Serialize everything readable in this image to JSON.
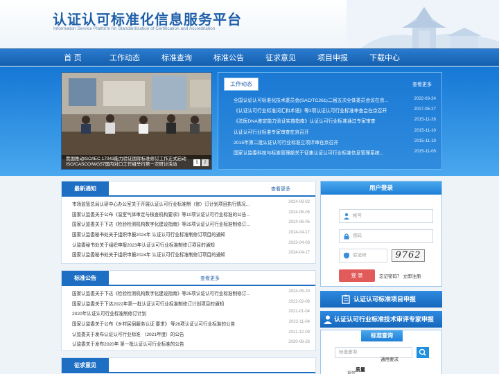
{
  "header": {
    "title": "认证认可标准化信息服务平台",
    "subtitle": "Information Service Platform for Standardization of Certification and Accreditation"
  },
  "nav": [
    "首 页",
    "工作动态",
    "标准查询",
    "标准公告",
    "征求意见",
    "项目申报",
    "下载中心"
  ],
  "slider": {
    "caption": "我国推动ISO/IEC 17043能力验证国际标准修订工作正式启动 ISO/CASCO/WG57国内对口工作组举行第一次研讨活动",
    "pages": [
      "1",
      "2"
    ]
  },
  "work_news": {
    "tab": "工作动态",
    "more": "查看更多",
    "items": [
      {
        "title": "全国认证认可标准化技术委员会(SAC/TC261)二届五次全体委员会议在京...",
        "date": "2022-03-24"
      },
      {
        "title": "《认证认可行业标准词汇和术语》等2项认证认可行业标准审查会在京召开",
        "date": "2017-06-27"
      },
      {
        "title": "《法医DNA鉴定能力验证实施指南》认证认可行业标准通过专家审查",
        "date": "2015-11-26"
      },
      {
        "title": "认证认可行业标准专家审查在京召开",
        "date": "2015-11-10"
      },
      {
        "title": "2015年第二批认证认可行业标准立项评审在京召开",
        "date": "2015-11-10"
      },
      {
        "title": "国家认监委科技与标准管理部关于征集认证认可行业标准信息管理系统...",
        "date": "2015-11-05"
      }
    ]
  },
  "latest_notice": {
    "tab": "最新通知",
    "more": "查看更多",
    "items": [
      {
        "title": "市场监管总局认研中心办公室关于开展认证认可行业标准制（修）订计划项目执行情况...",
        "date": "2024-09-02"
      },
      {
        "title": "国家认监委关于公布《温室气体审定与核查机构要求》等10项认证认可行业标准的公告...",
        "date": "2024-06-05"
      },
      {
        "title": "国家认监委关于下达《检验检测机构数字化建设指南》等25项认证认可行业标准制修订...",
        "date": "2024-06-05"
      },
      {
        "title": "国家认监委秘书处关于组织申报2024年 认证认可行业标准制修订项目的通知",
        "date": "2024-04-17"
      },
      {
        "title": "认监委秘书处关于组织申报2023年认证认可行业标准制修订项目的通知",
        "date": "2023-04-03"
      },
      {
        "title": "国家认监委秘书处关于组织申报2024年 认证认可行业标准制修订项目的通知",
        "date": "2024-04-17"
      }
    ]
  },
  "standard_notice": {
    "tab": "标准公告",
    "more": "查看更多",
    "items": [
      {
        "title": "国家认监委关于下达《检验检测机构数字化建设指南》等25项认证认可行业标准制修订...",
        "date": "2024-05-20"
      },
      {
        "title": "国家认监委关于下达2022年第一批认证认可行业标准制修订计划项目的通知",
        "date": "2022-02-08"
      },
      {
        "title": "2020年认证认可行业标准制修订计划",
        "date": "2021-01-04"
      },
      {
        "title": "国家认监委关于公布《乡村民宿服务认证 要求》 等26项认证认可行业标准的公告",
        "date": "2022-11-04"
      },
      {
        "title": "认监委关于发布认证认可行业标准 （2021年度）的公告",
        "date": "2021-12-09"
      },
      {
        "title": "认监委关于发布2020年 第一批认证认可行业标准的公告",
        "date": "2020-08-26"
      }
    ]
  },
  "consult": {
    "tab": "征求意见"
  },
  "login": {
    "title": "用户登录",
    "account_placeholder": "帐号",
    "password_placeholder": "密码",
    "captcha_placeholder": "验证码",
    "captcha_text": "9762",
    "login_label": "登 录",
    "forgot": "忘记密码？",
    "register": "立即注册"
  },
  "buttons": {
    "project_apply": "认证认可标准项目申报",
    "expert_apply": "认证认可行业标准技术审评专家申报"
  },
  "search": {
    "title": "标准查询",
    "placeholder": "标准查询",
    "hint": "通用要求",
    "tag1": "质量",
    "tag2": "规范"
  },
  "colors": {
    "primary": "#1e6fc3",
    "nav": "#145fae",
    "accent_red": "#e25b5b"
  }
}
